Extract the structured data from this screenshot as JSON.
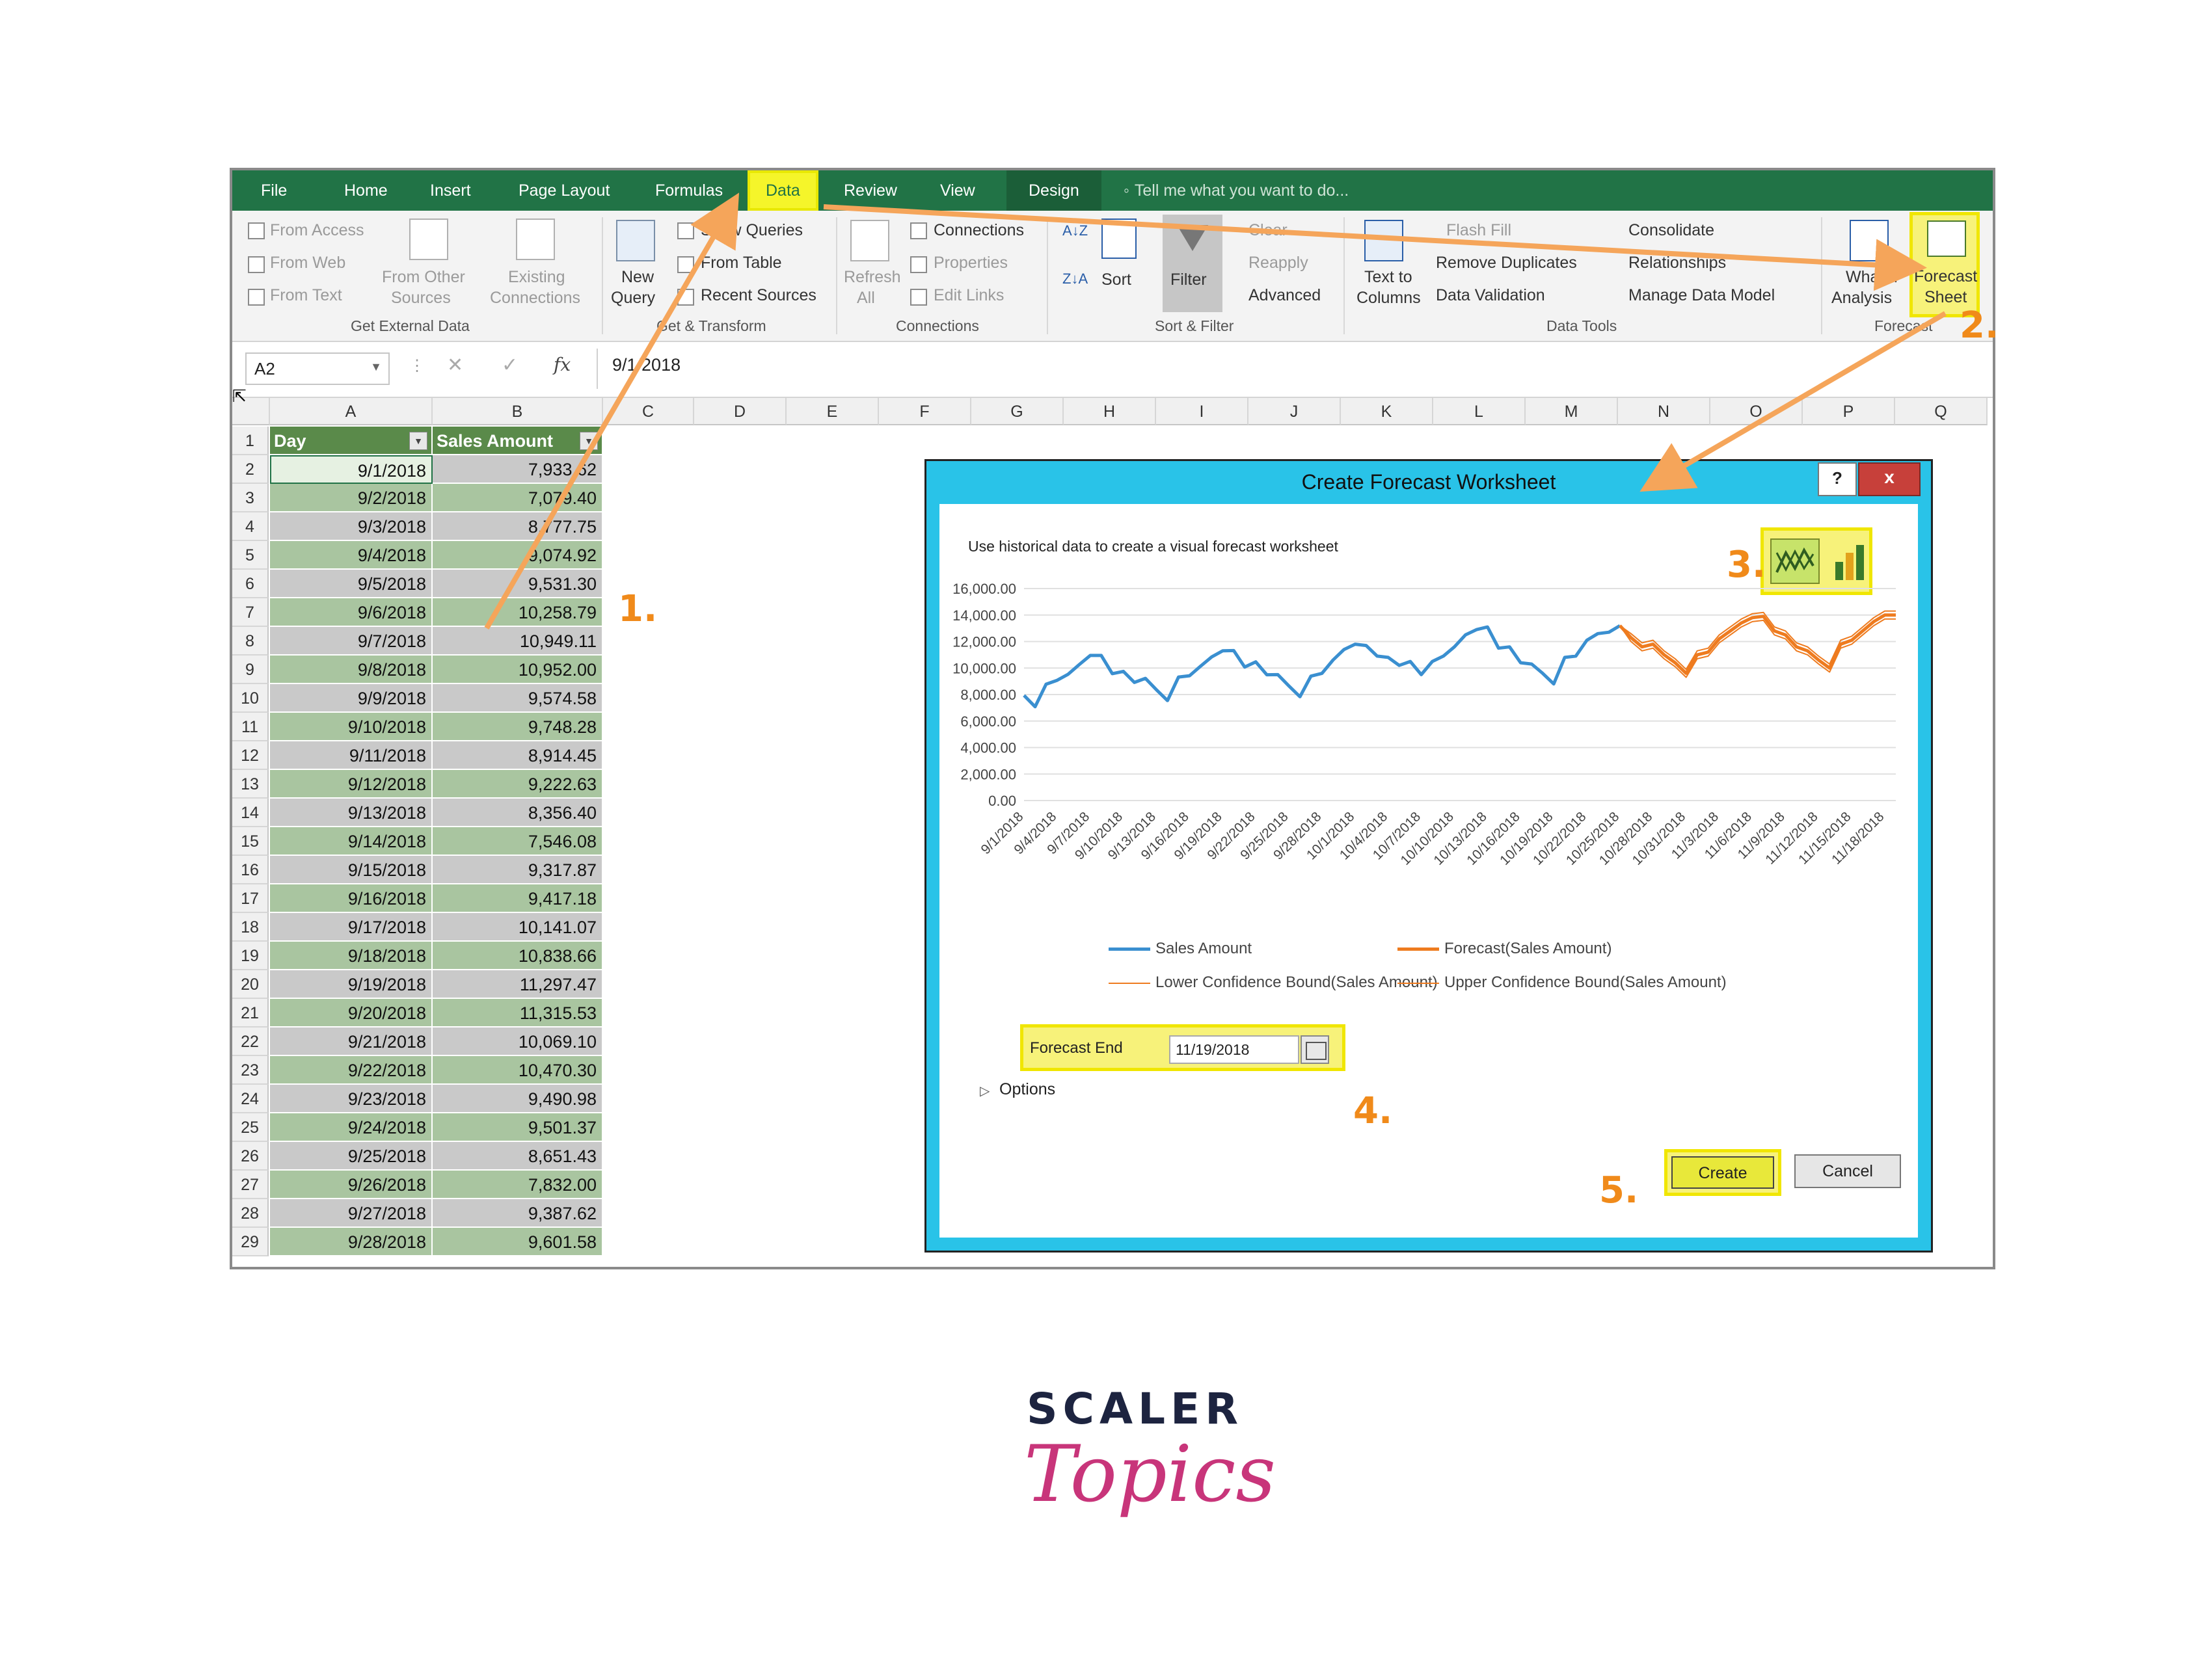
{
  "ribbon_tabs": [
    "File",
    "Home",
    "Insert",
    "Page Layout",
    "Formulas",
    "Data",
    "Review",
    "View",
    "Design"
  ],
  "tell_me": "Tell me what you want to do...",
  "ribbon": {
    "get_external": {
      "from_access": "From Access",
      "from_web": "From Web",
      "from_text": "From Text",
      "from_other_1": "From Other",
      "from_other_2": "Sources",
      "existing_1": "Existing",
      "existing_2": "Connections",
      "label": "Get External Data"
    },
    "get_transform": {
      "new_query_1": "New",
      "new_query_2": "Query",
      "show_queries": "Show Queries",
      "from_table": "From Table",
      "recent_sources": "Recent Sources",
      "label": "Get & Transform"
    },
    "connections": {
      "refresh_1": "Refresh",
      "refresh_2": "All",
      "connections": "Connections",
      "properties": "Properties",
      "edit_links": "Edit Links",
      "label": "Connections"
    },
    "sort_filter": {
      "sort": "Sort",
      "filter": "Filter",
      "clear": "Clear",
      "reapply": "Reapply",
      "advanced": "Advanced",
      "label": "Sort & Filter"
    },
    "data_tools": {
      "text_to_1": "Text to",
      "text_to_2": "Columns",
      "flash_fill": "Flash Fill",
      "remove_duplicates": "Remove Duplicates",
      "data_validation": "Data Validation",
      "consolidate": "Consolidate",
      "relationships": "Relationships",
      "manage_model": "Manage Data Model",
      "label": "Data Tools"
    },
    "forecast": {
      "whatif_1": "What-If",
      "whatif_2": "Analysis",
      "sheet_1": "Forecast",
      "sheet_2": "Sheet",
      "label": "Forecast"
    }
  },
  "formula_bar": {
    "name_box": "A2",
    "fx": "fx",
    "value": "9/1/2018"
  },
  "columns": [
    "A",
    "B",
    "C",
    "D",
    "E",
    "F",
    "G",
    "H",
    "I",
    "J",
    "K",
    "L",
    "M",
    "N",
    "O",
    "P",
    "Q"
  ],
  "table": {
    "headers": [
      "Day",
      "Sales Amount"
    ],
    "rows": [
      [
        "9/1/2018",
        "7,933.62"
      ],
      [
        "9/2/2018",
        "7,079.40"
      ],
      [
        "9/3/2018",
        "8,777.75"
      ],
      [
        "9/4/2018",
        "9,074.92"
      ],
      [
        "9/5/2018",
        "9,531.30"
      ],
      [
        "9/6/2018",
        "10,258.79"
      ],
      [
        "9/7/2018",
        "10,949.11"
      ],
      [
        "9/8/2018",
        "10,952.00"
      ],
      [
        "9/9/2018",
        "9,574.58"
      ],
      [
        "9/10/2018",
        "9,748.28"
      ],
      [
        "9/11/2018",
        "8,914.45"
      ],
      [
        "9/12/2018",
        "9,222.63"
      ],
      [
        "9/13/2018",
        "8,356.40"
      ],
      [
        "9/14/2018",
        "7,546.08"
      ],
      [
        "9/15/2018",
        "9,317.87"
      ],
      [
        "9/16/2018",
        "9,417.18"
      ],
      [
        "9/17/2018",
        "10,141.07"
      ],
      [
        "9/18/2018",
        "10,838.66"
      ],
      [
        "9/19/2018",
        "11,297.47"
      ],
      [
        "9/20/2018",
        "11,315.53"
      ],
      [
        "9/21/2018",
        "10,069.10"
      ],
      [
        "9/22/2018",
        "10,470.30"
      ],
      [
        "9/23/2018",
        "9,490.98"
      ],
      [
        "9/24/2018",
        "9,501.37"
      ],
      [
        "9/25/2018",
        "8,651.43"
      ],
      [
        "9/26/2018",
        "7,832.00"
      ],
      [
        "9/27/2018",
        "9,387.62"
      ],
      [
        "9/28/2018",
        "9,601.58"
      ]
    ]
  },
  "dialog": {
    "title": "Create Forecast Worksheet",
    "help": "?",
    "close": "x",
    "description": "Use historical data to create a visual forecast worksheet",
    "forecast_end_label": "Forecast End",
    "forecast_end_value": "11/19/2018",
    "options": "Options",
    "create": "Create",
    "cancel": "Cancel"
  },
  "annotations": [
    "1.",
    "2.",
    "3.",
    "4.",
    "5."
  ],
  "brand": {
    "line1": "SCALER",
    "line2": "Topics"
  },
  "colors": {
    "excel_green": "#217346",
    "highlight": "#f5f52a",
    "arrow": "#f5a55a",
    "actual": "#3a8fd0",
    "forecast": "#ee7b1f",
    "dialog_frame": "#29c3e8"
  },
  "chart_data": {
    "type": "line",
    "y_ticks": [
      "16,000.00",
      "14,000.00",
      "12,000.00",
      "10,000.00",
      "8,000.00",
      "6,000.00",
      "4,000.00",
      "2,000.00",
      "0.00"
    ],
    "ylim": [
      0,
      16000
    ],
    "x_tick_labels": [
      "9/1/2018",
      "9/4/2018",
      "9/7/2018",
      "9/10/2018",
      "9/13/2018",
      "9/16/2018",
      "9/19/2018",
      "9/22/2018",
      "9/25/2018",
      "9/28/2018",
      "10/1/2018",
      "10/4/2018",
      "10/7/2018",
      "10/10/2018",
      "10/13/2018",
      "10/16/2018",
      "10/19/2018",
      "10/22/2018",
      "10/25/2018",
      "10/28/2018",
      "10/31/2018",
      "11/3/2018",
      "11/6/2018",
      "11/9/2018",
      "11/12/2018",
      "11/15/2018",
      "11/18/2018"
    ],
    "series": [
      {
        "name": "Sales Amount",
        "start_index": 0,
        "values": [
          7933,
          7079,
          8778,
          9075,
          9531,
          10259,
          10949,
          10952,
          9575,
          9748,
          8914,
          9223,
          8356,
          7546,
          9318,
          9417,
          10141,
          10839,
          11297,
          11316,
          10069,
          10470,
          9491,
          9501,
          8651,
          7832,
          9388,
          9602,
          10600,
          11400,
          11800,
          11700,
          10900,
          10800,
          10200,
          10500,
          9500,
          10500,
          10900,
          11600,
          12500,
          12900,
          13100,
          11500,
          11600,
          10400,
          10300,
          9600,
          8800,
          10800,
          10900,
          12100,
          12600,
          12700,
          13200
        ]
      },
      {
        "name": "Forecast(Sales Amount)",
        "start_index": 54,
        "values": [
          13200,
          12300,
          11600,
          11800,
          11000,
          10400,
          9600,
          11000,
          11200,
          12200,
          12800,
          13400,
          13800,
          13900,
          12800,
          12500,
          11600,
          11300,
          10600,
          10000,
          11800,
          12100,
          12800,
          13500,
          14000,
          14000
        ]
      },
      {
        "name": "Lower Confidence Bound(Sales Amount)",
        "start_index": 54,
        "values": [
          13200,
          12000,
          11300,
          11500,
          10700,
          10100,
          9300,
          10700,
          10900,
          11900,
          12500,
          13100,
          13500,
          13600,
          12500,
          12200,
          11300,
          11000,
          10300,
          9700,
          11500,
          11800,
          12500,
          13200,
          13700,
          13700
        ]
      },
      {
        "name": "Upper Confidence Bound(Sales Amount)",
        "start_index": 54,
        "values": [
          13200,
          12600,
          11900,
          12100,
          11300,
          10700,
          9900,
          11300,
          11500,
          12500,
          13100,
          13700,
          14100,
          14200,
          13100,
          12800,
          11900,
          11600,
          10900,
          10300,
          12100,
          12400,
          13100,
          13800,
          14300,
          14300
        ]
      }
    ]
  }
}
